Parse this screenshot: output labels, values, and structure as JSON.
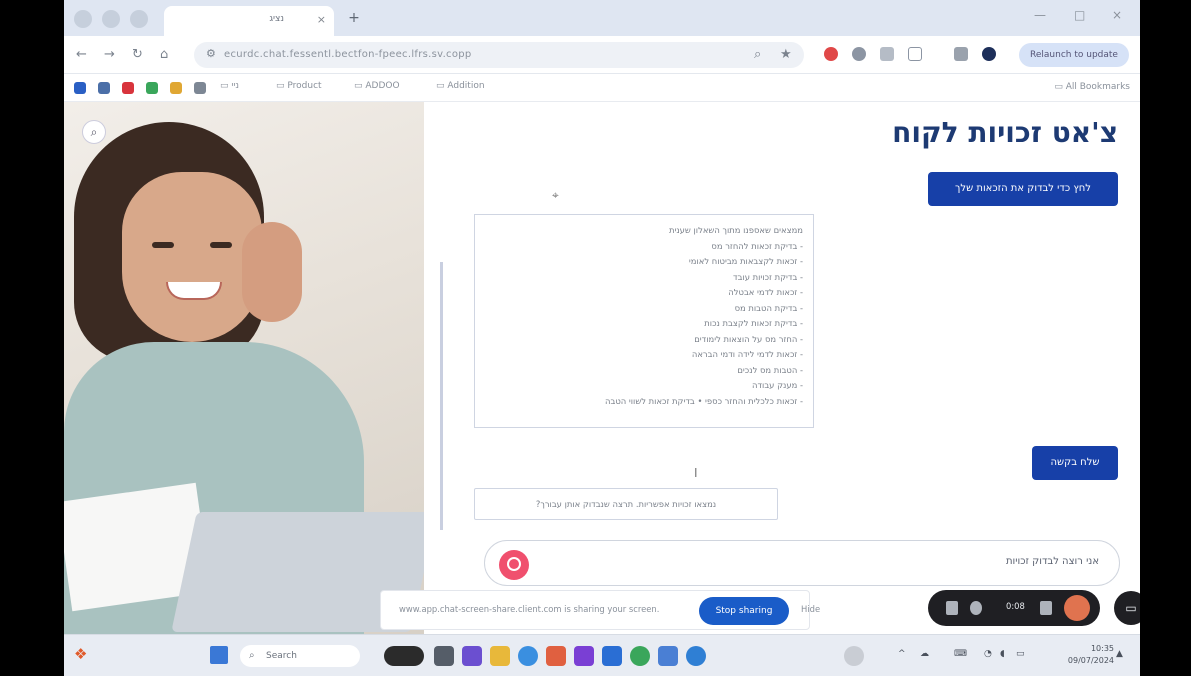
{
  "browser": {
    "tab_title": "נציג",
    "tab_close": "×",
    "new_tab": "+",
    "address_url": "ecurdc.chat.fessentl.bectfon-fpeec.lfrs.sv.copp",
    "profile_button": "Relaunch to update",
    "window_controls": [
      "—",
      "□",
      "×"
    ]
  },
  "bookmarks": {
    "folders": [
      "ניי",
      "Product",
      "ADDOO",
      "Addition"
    ],
    "all_bookmarks": "All Bookmarks"
  },
  "page": {
    "title": "צ'אט זכויות לקוח",
    "top_button": "לחץ כדי לבדוק את הזכאות שלך",
    "checklist": [
      "ממצאים שאספנו מתוך השאלון שענית",
      "- בדיקת זכאות להחזר מס",
      "- זכאות לקצבאות מביטוח לאומי",
      "- בדיקת זכויות עובד",
      "- זכאות לדמי אבטלה",
      "- בדיקת הטבות מס",
      "- בדיקת זכאות לקצבת נכות",
      "- החזר מס על הוצאות לימודים",
      "- זכאות לדמי לידה ודמי הבראה",
      "- הטבות מס לנכים",
      "- מענק עבודה",
      "- זכאות כלכלית והחזר כספי • בדיקת זכאות לשווי הטבה"
    ],
    "reply_text": "נמצאו זכויות אפשריות. תרצה שנבדוק אותן עבורך?",
    "send_button": "שלח בקשה",
    "input_placeholder": "אני רוצה לבדוק זכויות"
  },
  "share_banner": {
    "text": "www.app.chat-screen-share.client.com is sharing your screen.",
    "stop_button": "Stop sharing",
    "hide_button": "Hide"
  },
  "recorder": {
    "time": "0:08"
  },
  "taskbar": {
    "search_placeholder": "Search",
    "clock_time": "10:35",
    "clock_date": "09/07/2024"
  },
  "colors": {
    "primary": "#1740a8",
    "title": "#1d3a73",
    "accent": "#f0506e"
  }
}
